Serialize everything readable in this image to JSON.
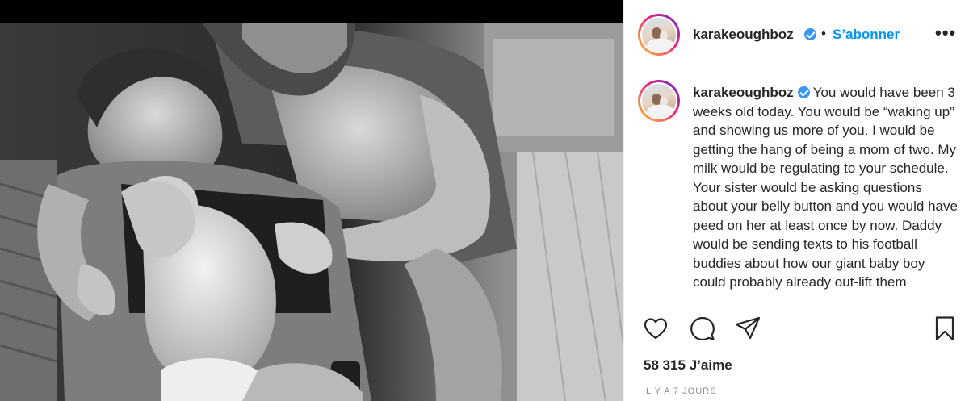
{
  "post": {
    "username": "karakeoughboz",
    "verified": true,
    "separator": "•",
    "follow_label": "S’abonner",
    "more_icon": "more-horizontal-icon",
    "more_label": "•••",
    "caption": "You would have been 3 weeks old today. You would be “waking up” and showing us more of you. I would be getting the hang of being a mom of two. My milk would be regulating to your schedule. Your sister would be asking questions about your belly button and you would have peed on her at least once by now. Daddy would be sending texts to his football buddies about how our giant baby boy could probably already out-lift them",
    "likes": "58 315 J’aime",
    "time_ago": "IL Y A 7 JOURS",
    "photo": "black-and-white photo of a mother holding a newborn baby with the father leaning over them"
  },
  "actions": [
    {
      "name": "like",
      "icon": "heart-icon"
    },
    {
      "name": "comment",
      "icon": "comment-icon"
    },
    {
      "name": "share",
      "icon": "paper-plane-icon"
    },
    {
      "name": "save",
      "icon": "bookmark-icon"
    }
  ],
  "colors": {
    "accent": "#0095f6",
    "verified": "#3897f0",
    "text": "#262626",
    "muted": "#8e8e8e",
    "border": "#efefef"
  }
}
